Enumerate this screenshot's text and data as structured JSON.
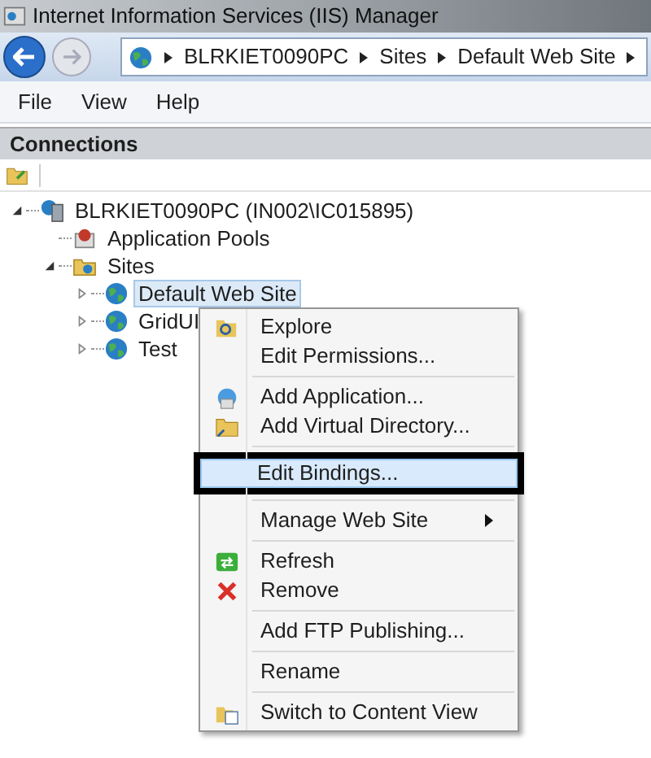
{
  "window": {
    "title": "Internet Information Services (IIS) Manager"
  },
  "address_bar": {
    "segments": [
      "BLRKIET0090PC",
      "Sites",
      "Default Web Site"
    ]
  },
  "menu_bar": [
    "File",
    "View",
    "Help"
  ],
  "connections": {
    "title": "Connections",
    "tree": [
      {
        "label": "BLRKIET0090PC (IN002\\IC015895)",
        "expanded": true,
        "selected": false,
        "children": [
          {
            "label": "Application Pools",
            "selected": false
          },
          {
            "label": "Sites",
            "expanded": true,
            "selected": false,
            "children": [
              {
                "label": "Default Web Site",
                "expanded": false,
                "selected": true
              },
              {
                "label": "GridUI",
                "expanded": false,
                "selected": false
              },
              {
                "label": "Test",
                "expanded": false,
                "selected": false
              }
            ]
          }
        ]
      }
    ]
  },
  "context_menu": {
    "items": [
      {
        "kind": "item",
        "label": "Explore",
        "selected": false
      },
      {
        "kind": "item",
        "label": "Edit Permissions...",
        "selected": false
      },
      {
        "kind": "separator"
      },
      {
        "kind": "item",
        "label": "Add Application...",
        "selected": false
      },
      {
        "kind": "item",
        "label": "Add Virtual Directory...",
        "selected": false
      },
      {
        "kind": "separator"
      },
      {
        "kind": "item",
        "label": "Edit Bindings...",
        "selected": true,
        "outlined": true
      },
      {
        "kind": "separator"
      },
      {
        "kind": "submenu",
        "label": "Manage Web Site",
        "selected": false
      },
      {
        "kind": "separator"
      },
      {
        "kind": "item",
        "label": "Refresh",
        "selected": false
      },
      {
        "kind": "item",
        "label": "Remove",
        "selected": false
      },
      {
        "kind": "separator"
      },
      {
        "kind": "item",
        "label": "Add FTP Publishing...",
        "selected": false
      },
      {
        "kind": "separator"
      },
      {
        "kind": "item",
        "label": "Rename",
        "selected": false
      },
      {
        "kind": "separator"
      },
      {
        "kind": "item",
        "label": "Switch to Content View",
        "selected": false
      }
    ]
  }
}
